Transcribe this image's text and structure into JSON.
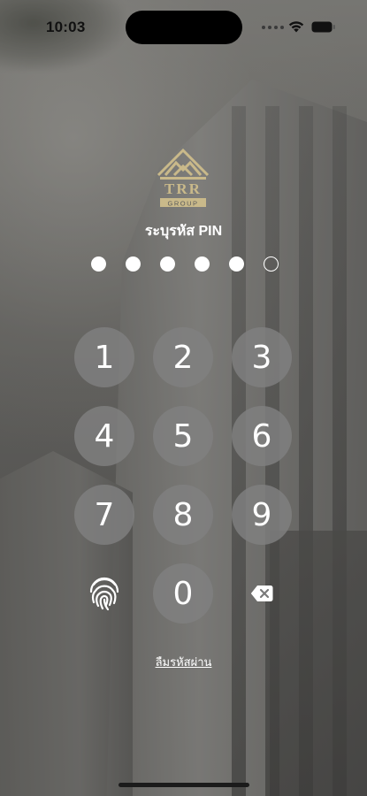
{
  "status_bar": {
    "time": "10:03"
  },
  "logo": {
    "letters": "TRR",
    "sub": "GROUP"
  },
  "pin": {
    "title": "ระบุรหัส PIN",
    "digits_total": 6,
    "digits_filled": 5
  },
  "keypad": {
    "keys": [
      "1",
      "2",
      "3",
      "4",
      "5",
      "6",
      "7",
      "8",
      "9",
      "0"
    ],
    "fingerprint_icon": "fingerprint-icon",
    "delete_icon": "backspace-icon"
  },
  "forgot_link": "ลืมรหัสผ่าน",
  "colors": {
    "key_bg": "#808080",
    "logo_gold": "#c9b98a"
  }
}
